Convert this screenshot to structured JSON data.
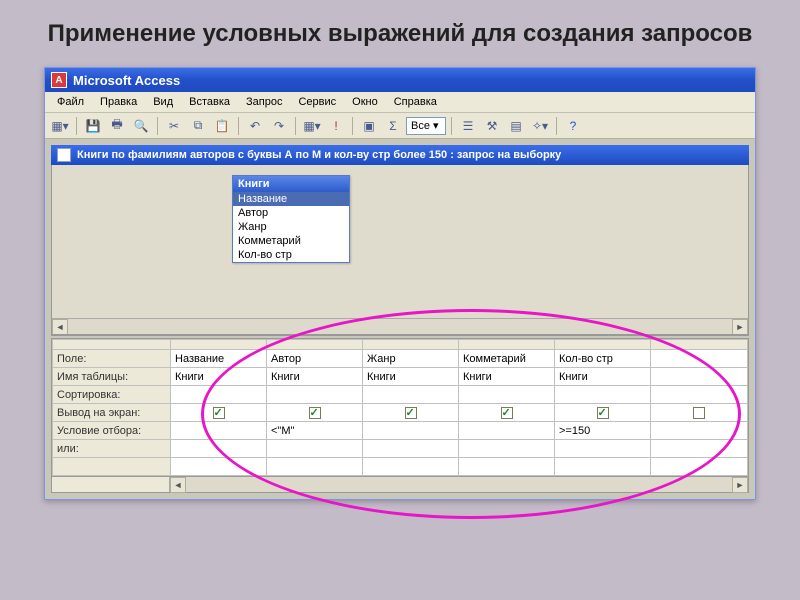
{
  "slide": {
    "title": "Применение условных выражений для создания запросов"
  },
  "app": {
    "name": "Microsoft Access"
  },
  "menubar": {
    "items": [
      "Файл",
      "Правка",
      "Вид",
      "Вставка",
      "Запрос",
      "Сервис",
      "Окно",
      "Справка"
    ]
  },
  "toolbar": {
    "combo_label": "Все"
  },
  "document": {
    "title": "Книги по фамилиям авторов с буквы А по М и кол-ву стр более 150 : запрос на выборку"
  },
  "table_box": {
    "title": "Книги",
    "fields": [
      "Название",
      "Автор",
      "Жанр",
      "Комметарий",
      "Кол-во стр"
    ],
    "selected_index": 0
  },
  "design_grid": {
    "row_labels": {
      "field": "Поле:",
      "table": "Имя таблицы:",
      "sort": "Сортировка:",
      "show": "Вывод на экран:",
      "criteria": "Условие отбора:",
      "or": "или:"
    },
    "columns": [
      {
        "field": "Название",
        "table": "Книги",
        "sort": "",
        "show": true,
        "criteria": "",
        "or": ""
      },
      {
        "field": "Автор",
        "table": "Книги",
        "sort": "",
        "show": true,
        "criteria": "<\"М\"",
        "or": ""
      },
      {
        "field": "Жанр",
        "table": "Книги",
        "sort": "",
        "show": true,
        "criteria": "",
        "or": ""
      },
      {
        "field": "Комметарий",
        "table": "Книги",
        "sort": "",
        "show": true,
        "criteria": "",
        "or": ""
      },
      {
        "field": "Кол-во стр",
        "table": "Книги",
        "sort": "",
        "show": true,
        "criteria": ">=150",
        "or": ""
      }
    ]
  }
}
